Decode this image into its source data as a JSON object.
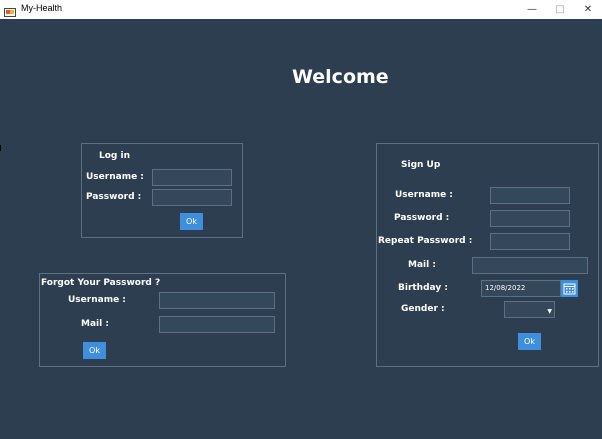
{
  "window": {
    "title": "My-Health",
    "minimize": "—",
    "maximize": "□",
    "close": "✕"
  },
  "welcome": "Welcome",
  "login": {
    "title": "Log in",
    "username_label": "Username :",
    "password_label": "Password :",
    "username_value": "",
    "password_value": "",
    "ok_label": "Ok"
  },
  "forgot": {
    "title": "Forgot Your Password ?",
    "username_label": "Username :",
    "mail_label": "Mail :",
    "username_value": "",
    "mail_value": "",
    "ok_label": "Ok"
  },
  "signup": {
    "title": "Sign Up",
    "username_label": "Username :",
    "password_label": "Password :",
    "repeat_password_label": "Repeat Password :",
    "mail_label": "Mail :",
    "birthday_label": "Birthday :",
    "gender_label": "Gender :",
    "username_value": "",
    "password_value": "",
    "repeat_password_value": "",
    "mail_value": "",
    "birthday_value": "12/08/2022",
    "gender_value": "",
    "ok_label": "Ok"
  },
  "colors": {
    "background": "#2d3e50",
    "accent": "#3f8fdc",
    "panel_border": "#5e6f80",
    "field": "#34475b"
  },
  "icons": {
    "app": "app-logo-icon",
    "calendar": "calendar-icon",
    "dropdown": "chevron-down-icon"
  }
}
